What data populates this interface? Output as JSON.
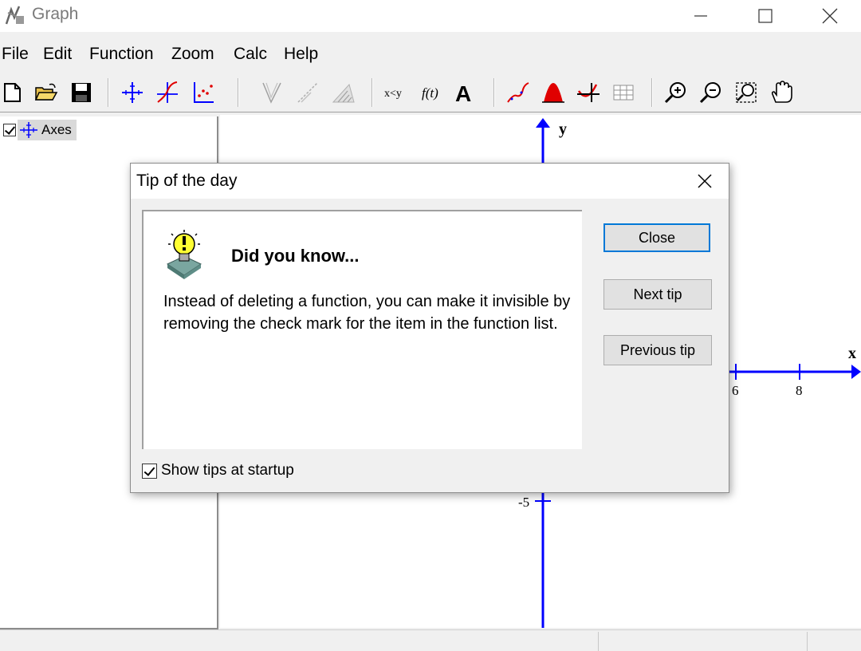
{
  "window": {
    "title": "Graph"
  },
  "menu": [
    "File",
    "Edit",
    "Function",
    "Zoom",
    "Calc",
    "Help"
  ],
  "toolbar_icons": [
    "new-file-icon",
    "open-folder-icon",
    "save-icon",
    "axes-icon",
    "insert-function-icon",
    "insert-point-series-icon",
    "tangent-icon",
    "shade-icon",
    "relation-icon",
    "x-y-table-icon",
    "function-fx-icon",
    "text-label-icon",
    "trendline-icon",
    "area-icon",
    "evaluate-icon",
    "table-icon",
    "zoom-in-icon",
    "zoom-out-icon",
    "zoom-window-icon",
    "hand-move-icon"
  ],
  "function_list": {
    "items": [
      {
        "label": "Axes",
        "checked": true
      }
    ]
  },
  "graph": {
    "y_axis_label": "y",
    "x_axis_label": "x",
    "x_tick_labels": [
      "6",
      "8"
    ],
    "y_tick_labels": [
      "-5"
    ],
    "axis_color": "#0000ff"
  },
  "dialog": {
    "title": "Tip of the day",
    "heading": "Did you know...",
    "tip_text": "Instead of deleting a function, you can make it invisible by removing the check mark for the item in the function list.",
    "buttons": {
      "close": "Close",
      "next": "Next tip",
      "previous": "Previous tip"
    },
    "show_tips_label": "Show tips at startup",
    "show_tips_checked": true
  },
  "colors": {
    "accent": "#0078d7",
    "axis": "#0000ff",
    "red_icon": "#e00000"
  }
}
